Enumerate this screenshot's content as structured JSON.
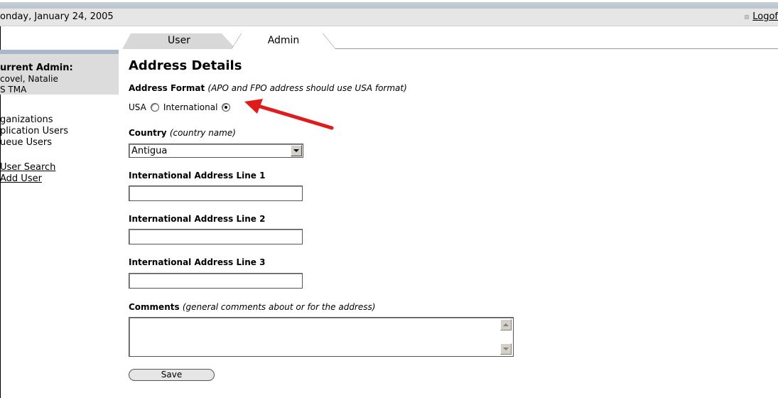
{
  "header": {
    "date": "onday, January 24, 2005",
    "logoff_label": "Logof"
  },
  "tabs": [
    {
      "label": "User",
      "active": false
    },
    {
      "label": "Admin",
      "active": true
    }
  ],
  "sidebar": {
    "heading": "urrent Admin:",
    "admin_name": "covel, Natalie",
    "admin_org": "S TMA",
    "nav_items": [
      {
        "label": "ganizations"
      },
      {
        "label": "plication Users"
      },
      {
        "label": "ueue Users"
      }
    ],
    "links": [
      {
        "label": "User  Search"
      },
      {
        "label": "Add User"
      }
    ]
  },
  "form": {
    "title": "Address Details",
    "address_format": {
      "label": "Address Format",
      "hint": "(APO and FPO address should use USA format)",
      "options": [
        {
          "label": "USA",
          "checked": false
        },
        {
          "label": "International",
          "checked": true
        }
      ]
    },
    "country": {
      "label": "Country",
      "hint": "(country name)",
      "value": "Antigua"
    },
    "line1": {
      "label": "International Address Line 1",
      "value": ""
    },
    "line2": {
      "label": "International Address Line 2",
      "value": ""
    },
    "line3": {
      "label": "International Address Line 3",
      "value": ""
    },
    "comments": {
      "label": "Comments",
      "hint": "(general comments about or for the address)",
      "value": ""
    },
    "save_label": "Save"
  },
  "colors": {
    "annotation_arrow": "#e01b1b",
    "sidebar_box": "#dcdcdc",
    "date_bar": "#e6e6e6"
  }
}
